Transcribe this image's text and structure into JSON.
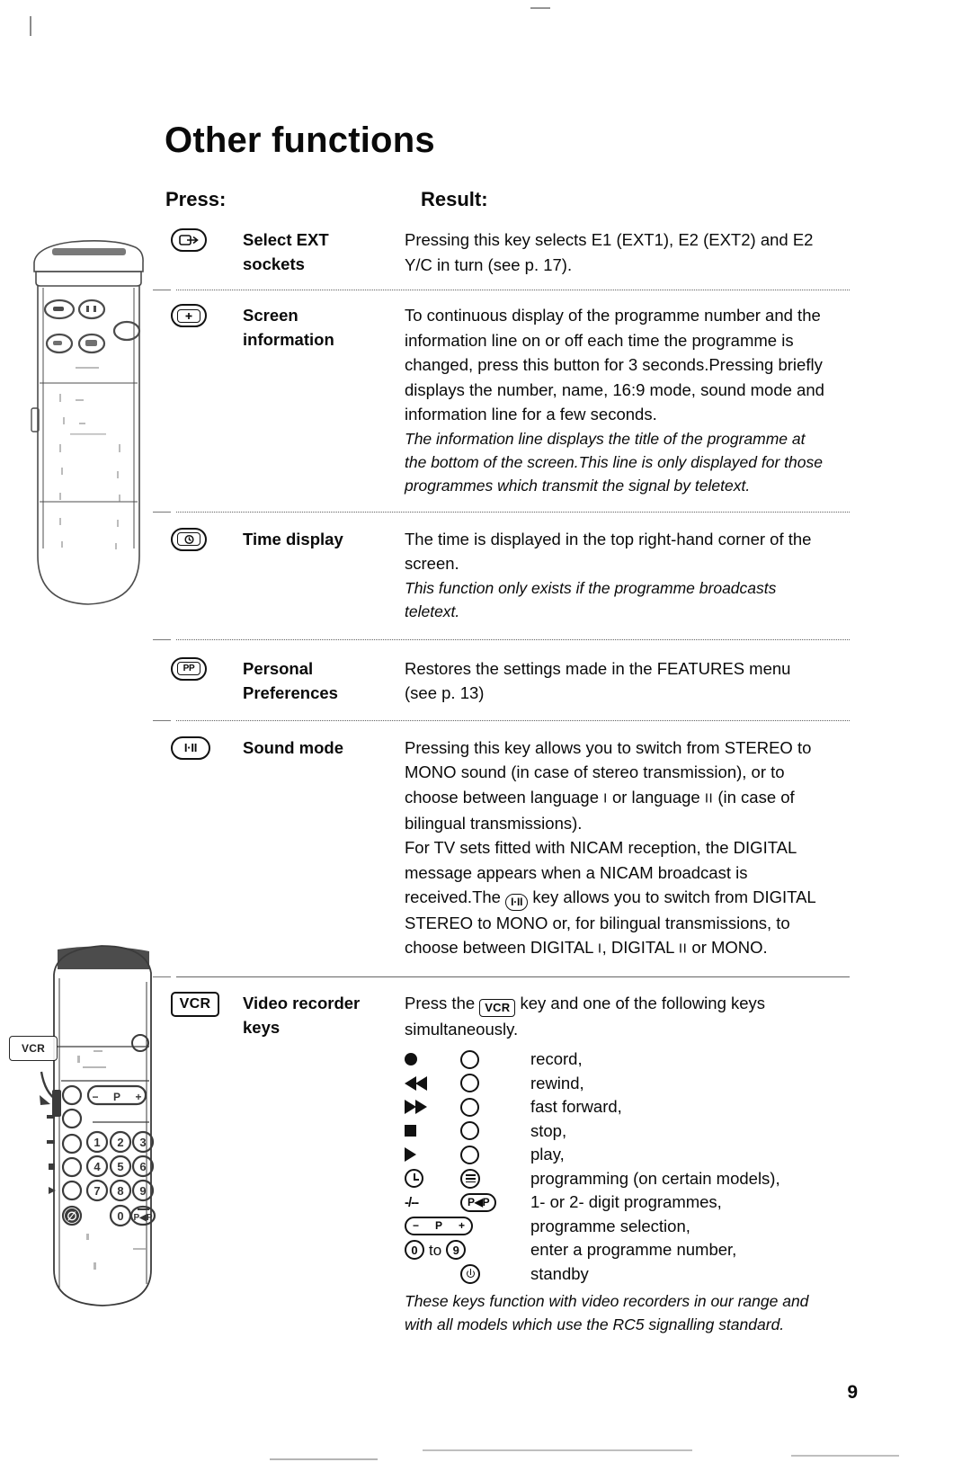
{
  "page": {
    "title": "Other functions",
    "number": "9",
    "columns": {
      "press": "Press:",
      "result": "Result:"
    }
  },
  "rows": [
    {
      "key_icon": "ext-sockets-key-icon",
      "key_label": "EXT",
      "name": "Select EXT\nsockets",
      "name_lines": [
        "Select EXT",
        "sockets"
      ],
      "body": "Pressing this key selects E1 (EXT1), E2 (EXT2) and E2 Y/C in turn (see p. 17).",
      "note": ""
    },
    {
      "key_icon": "screen-information-key-icon",
      "key_label": "i+",
      "name_lines": [
        "Screen",
        "information"
      ],
      "body": "To continuous display of the programme number and the information line on or off each time the programme is changed, press this button for 3 seconds.Pressing briefly displays the number, name, 16:9 mode, sound mode and information line for a few seconds.",
      "note": "The information line displays the title of the programme at the bottom of the screen.This line is only displayed for those programmes which transmit the signal by teletext."
    },
    {
      "key_icon": "time-display-key-icon",
      "key_label": "clock",
      "name_lines": [
        "Time display"
      ],
      "body": "The time is displayed in the top right-hand corner of the screen.",
      "note": "This function only exists if the programme broadcasts teletext."
    },
    {
      "key_icon": "personal-preferences-key-icon",
      "key_label": "PP",
      "name_lines": [
        "Personal",
        "Preferences"
      ],
      "body_parts": [
        "Restores the settings made in the FEATURES menu",
        "(see p. 13)"
      ],
      "note": ""
    },
    {
      "key_icon": "sound-mode-key-icon",
      "key_label": "I·II",
      "name_lines": [
        "Sound mode"
      ],
      "sound_mode": {
        "p1_a": "Pressing this key allows you to switch from STEREO to MONO sound (in case of stereo transmission), or to choose between language ",
        "p1_rn1": "I",
        "p1_b": " or language ",
        "p1_rn2": "II",
        "p1_c": " (in case of bilingual transmissions).",
        "p2_a": "For TV sets fitted with NICAM reception, the DIGITAL message appears when a NICAM broadcast is received.The ",
        "p2_key": "I·II",
        "p2_b": " key allows you to switch from DIGITAL STEREO to MONO or, for bilingual transmissions, to choose between DIGITAL ",
        "p2_rn1": "I",
        "p2_c": ", DIGITAL ",
        "p2_rn2": "II",
        "p2_d": " or MONO."
      }
    },
    {
      "key_icon": "vcr-key-icon",
      "key_label": "VCR",
      "name_lines": [
        "Video recorder",
        "keys"
      ],
      "vcr": {
        "intro_a": "Press the ",
        "intro_key": "VCR",
        "intro_b": " key and one of the following keys simultaneously.",
        "keys": [
          {
            "glyph_a": "record-dot-icon",
            "glyph_b": "open-circle-icon",
            "label": "record,"
          },
          {
            "glyph_a": "rewind-icon",
            "glyph_b": "open-circle-icon",
            "label": "rewind,"
          },
          {
            "glyph_a": "fast-forward-icon",
            "glyph_b": "open-circle-icon",
            "label": "fast forward,"
          },
          {
            "glyph_a": "stop-icon",
            "glyph_b": "open-circle-icon",
            "label": "stop,"
          },
          {
            "glyph_a": "play-icon",
            "glyph_b": "open-circle-icon",
            "label": "play,"
          },
          {
            "glyph_a": "clock-icon",
            "glyph_b": "menu-icon",
            "label": "programming (on certain models),"
          },
          {
            "glyph_a": "digit-dashes-icon",
            "glyph_b": "prev-programme-icon",
            "label": "1- or 2- digit programmes,"
          },
          {
            "glyph_a": "programme-rocker-icon",
            "glyph_b": "",
            "label": "programme selection,"
          },
          {
            "glyph_a": "digit-range-icon",
            "glyph_b": "",
            "label": "enter a programme number,"
          },
          {
            "glyph_a": "",
            "glyph_b": "standby-icon",
            "label": "standby"
          }
        ],
        "rocker": {
          "minus": "−",
          "p": "P",
          "plus": "+"
        },
        "digit_range": {
          "from": "0",
          "to": "to",
          "until": "9"
        },
        "dashes": "-/--",
        "pap": "P◀P",
        "note": "These keys function with video recorders in our range and with all models which use the RC5 signalling standard."
      }
    }
  ],
  "illustrations": {
    "top_remote": "remote-control-top-illustration",
    "bottom_remote": "remote-control-bottom-illustration",
    "vcr_callout": "VCR",
    "keypad_digits": [
      "1",
      "2",
      "3",
      "4",
      "5",
      "6",
      "7",
      "8",
      "9",
      "0"
    ],
    "rocker": {
      "minus": "−",
      "p": "P",
      "plus": "+"
    },
    "pap": "P◀P"
  }
}
